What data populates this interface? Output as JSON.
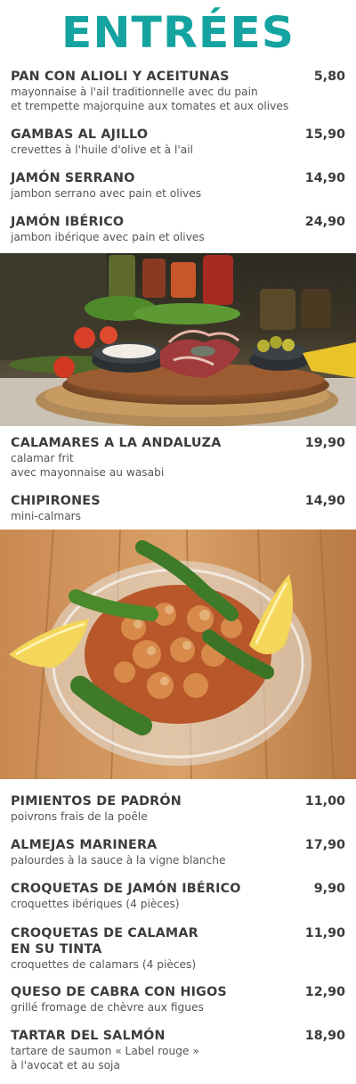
{
  "heading": "ENTRÉES",
  "items": [
    {
      "name": "PAN CON ALIOLI Y ACEITUNAS",
      "price": "5,80",
      "desc": [
        "mayonnaise à l'ail traditionnelle avec du pain",
        "et trempette majorquine aux tomates et aux olives"
      ]
    },
    {
      "name": "GAMBAS AL AJILLO",
      "price": "15,90",
      "desc": [
        "crevettes à l'huile d'olive et à l'ail"
      ]
    },
    {
      "name": "JAMÓN SERRANO",
      "price": "14,90",
      "desc": [
        "jambon serrano avec pain et olives"
      ]
    },
    {
      "name": "JAMÓN IBÉRICO",
      "price": "24,90",
      "desc": [
        "jambon ibérique avec pain et olives"
      ]
    },
    {
      "name": "CALAMARES A LA ANDALUZA",
      "price": "19,90",
      "desc": [
        "calamar frit",
        "avec mayonnaise au wasabi"
      ]
    },
    {
      "name": "CHIPIRONES",
      "price": "14,90",
      "desc": [
        "mini-calmars"
      ]
    },
    {
      "name": "PIMIENTOS DE PADRÓN",
      "price": "11,00",
      "desc": [
        "poivrons frais de la poêle"
      ]
    },
    {
      "name": "ALMEJAS MARINERA",
      "price": "17,90",
      "desc": [
        "palourdes à la sauce à la vigne blanche"
      ]
    },
    {
      "name": "CROQUETAS DE JAMÓN IBÉRICO",
      "price": "9,90",
      "desc": [
        "croquettes ibériques (4 pièces)"
      ]
    },
    {
      "name": [
        "CROQUETAS DE CALAMAR",
        "EN SU TINTA"
      ],
      "price": "11,90",
      "desc": [
        "croquettes de calamars (4 pièces)"
      ]
    },
    {
      "name": "QUESO DE CABRA CON HIGOS",
      "price": "12,90",
      "desc": [
        "grillé fromage de chèvre aux figues"
      ]
    },
    {
      "name": "TARTAR DEL SALMÓN",
      "price": "18,90",
      "desc": [
        "tartare de saumon « Label rouge »",
        "à l'avocat et au soja"
      ]
    }
  ],
  "photos": [
    {
      "icon": "ham-platter-photo"
    },
    {
      "icon": "fried-calamari-photo"
    }
  ]
}
